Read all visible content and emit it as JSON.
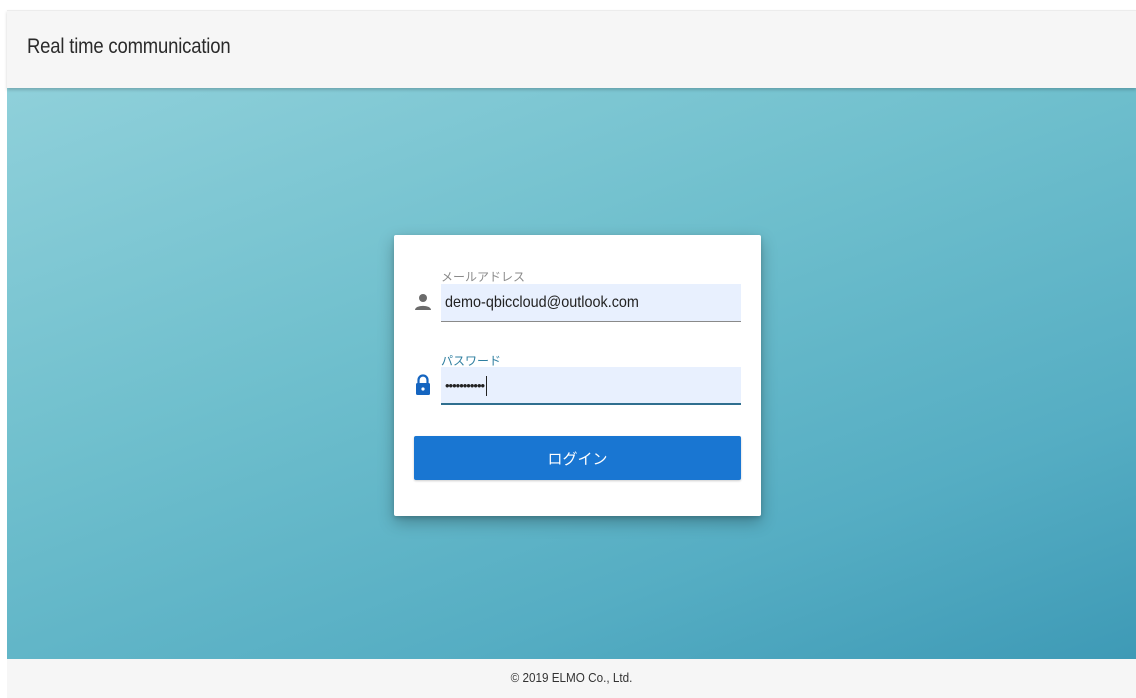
{
  "header": {
    "title": "Real time communication"
  },
  "login": {
    "email": {
      "label": "メールアドレス",
      "value": "demo-qbiccloud@outlook.com",
      "icon": "person-icon"
    },
    "password": {
      "label": "パスワード",
      "masked_value": "•••••••••••",
      "icon": "lock-icon"
    },
    "submit_label": "ログイン"
  },
  "footer": {
    "copyright": "© 2019 ELMO Co., Ltd."
  },
  "colors": {
    "header_bg": "#f6f6f6",
    "button_bg": "#1976d2",
    "input_bg": "#e8f0fe",
    "focus_accent": "#2f6f8f",
    "background_gradient_start": "#8fd0da",
    "background_gradient_end": "#3e9ab6"
  }
}
